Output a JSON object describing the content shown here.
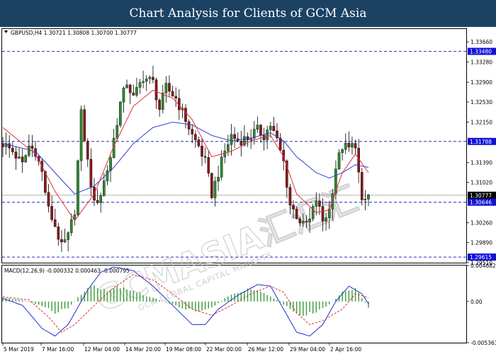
{
  "page_title": "Chart Analysis for Clients of GCM Asia",
  "watermark": {
    "main": "GCMASIA汇汇汇",
    "sub": "GCM GLOBAL CAPITAL MARKETS"
  },
  "colors": {
    "header_bg": "#1b4263",
    "bull_candle": "#2e8b2e",
    "bear_candle": "#8b1a1a",
    "ma_fast": "#e0303a",
    "ma_slow": "#2f3fd0",
    "level_line": "#2030c0",
    "label_bg": "#1010d8",
    "macd_hist": "#3a9a3a",
    "macd_signal": "#e03030",
    "macd_line": "#1f2fd0"
  },
  "chart_data": [
    {
      "type": "candlestick",
      "header": "GBPUSD,H4  1.30721 1.30808 1.30700 1.30777",
      "symbol": "GBPUSD",
      "timeframe": "H4",
      "ohlc_last": {
        "open": 1.30721,
        "high": 1.30808,
        "low": 1.307,
        "close": 1.30777
      },
      "ylim": [
        1.2951,
        1.339
      ],
      "y_ticks": [
        "1.33660",
        "1.33280",
        "1.32900",
        "1.32530",
        "1.32150",
        "1.31390",
        "1.31020",
        "1.30260",
        "1.29890",
        "1.29510"
      ],
      "x_ticks": [
        "5 Mar 2019",
        "7 Mar 16:00",
        "12 Mar 04:00",
        "14 Mar 20:00",
        "19 Mar 08:00",
        "22 Mar 00:00",
        "26 Mar 12:00",
        "29 Mar 04:00",
        "2 Apr 16:00"
      ],
      "levels": [
        {
          "value": 1.3348,
          "label": "1.33480"
        },
        {
          "value": 1.31788,
          "label": "1.31788"
        },
        {
          "value": 1.30646,
          "label": "1.30646"
        },
        {
          "value": 1.29615,
          "label": "1.29615"
        }
      ],
      "current_price": {
        "value": 1.30777,
        "label": "1.30777"
      },
      "close_path": [
        [
          0,
          1.3175
        ],
        [
          3,
          1.316
        ],
        [
          6,
          1.3135
        ],
        [
          8,
          1.317
        ],
        [
          10,
          1.316
        ],
        [
          12,
          1.312
        ],
        [
          14,
          1.305
        ],
        [
          16,
          1.302
        ],
        [
          18,
          1.298
        ],
        [
          20,
          1.3
        ],
        [
          22,
          1.305
        ],
        [
          24,
          1.323
        ],
        [
          26,
          1.314
        ],
        [
          28,
          1.306
        ],
        [
          30,
          1.308
        ],
        [
          33,
          1.315
        ],
        [
          36,
          1.325
        ],
        [
          38,
          1.329
        ],
        [
          40,
          1.326
        ],
        [
          43,
          1.33
        ],
        [
          46,
          1.329
        ],
        [
          48,
          1.324
        ],
        [
          50,
          1.328
        ],
        [
          53,
          1.326
        ],
        [
          56,
          1.322
        ],
        [
          58,
          1.319
        ],
        [
          60,
          1.317
        ],
        [
          62,
          1.314
        ],
        [
          64,
          1.308
        ],
        [
          66,
          1.312
        ],
        [
          68,
          1.316
        ],
        [
          70,
          1.319
        ],
        [
          72,
          1.318
        ],
        [
          75,
          1.3185
        ],
        [
          78,
          1.32
        ],
        [
          80,
          1.319
        ],
        [
          82,
          1.321
        ],
        [
          84,
          1.318
        ],
        [
          86,
          1.314
        ],
        [
          88,
          1.306
        ],
        [
          90,
          1.304
        ],
        [
          92,
          1.302
        ],
        [
          94,
          1.303
        ],
        [
          96,
          1.307
        ],
        [
          98,
          1.303
        ],
        [
          100,
          1.305
        ],
        [
          102,
          1.313
        ],
        [
          104,
          1.317
        ],
        [
          106,
          1.3165
        ],
        [
          108,
          1.3175
        ],
        [
          110,
          1.306
        ],
        [
          112,
          1.30777
        ]
      ],
      "ma_fast_path": [
        [
          0,
          1.3205
        ],
        [
          10,
          1.3155
        ],
        [
          16,
          1.3085
        ],
        [
          22,
          1.303
        ],
        [
          28,
          1.308
        ],
        [
          34,
          1.317
        ],
        [
          40,
          1.3245
        ],
        [
          46,
          1.3275
        ],
        [
          52,
          1.326
        ],
        [
          58,
          1.322
        ],
        [
          64,
          1.315
        ],
        [
          70,
          1.316
        ],
        [
          76,
          1.318
        ],
        [
          82,
          1.319
        ],
        [
          86,
          1.315
        ],
        [
          90,
          1.308
        ],
        [
          96,
          1.3045
        ],
        [
          100,
          1.305
        ],
        [
          104,
          1.312
        ],
        [
          108,
          1.3155
        ],
        [
          112,
          1.312
        ]
      ],
      "ma_slow_path": [
        [
          0,
          1.3175
        ],
        [
          10,
          1.316
        ],
        [
          16,
          1.312
        ],
        [
          22,
          1.308
        ],
        [
          28,
          1.3095
        ],
        [
          34,
          1.313
        ],
        [
          40,
          1.3175
        ],
        [
          46,
          1.3205
        ],
        [
          52,
          1.3215
        ],
        [
          58,
          1.321
        ],
        [
          64,
          1.319
        ],
        [
          70,
          1.318
        ],
        [
          76,
          1.3185
        ],
        [
          82,
          1.3195
        ],
        [
          86,
          1.318
        ],
        [
          90,
          1.315
        ],
        [
          96,
          1.312
        ],
        [
          100,
          1.311
        ],
        [
          104,
          1.312
        ],
        [
          108,
          1.3135
        ],
        [
          112,
          1.313
        ]
      ]
    },
    {
      "type": "macd",
      "header": "MACD(12,26,9) -0.000332 0.000463 -0.000795",
      "params": "12,26,9",
      "values": {
        "macd": -0.000332,
        "signal": 0.000463,
        "histogram": -0.000795
      },
      "ylim": [
        -0.005363,
        0.004682
      ],
      "y_ticks": [
        "0.004682",
        "0.00",
        "-0.005363"
      ],
      "hist_path": [
        [
          0,
          0.0005
        ],
        [
          6,
          0.0002
        ],
        [
          12,
          -0.0006
        ],
        [
          16,
          -0.0014
        ],
        [
          20,
          -0.0009
        ],
        [
          24,
          0.001
        ],
        [
          28,
          0.0022
        ],
        [
          32,
          0.0015
        ],
        [
          36,
          0.002
        ],
        [
          40,
          0.0014
        ],
        [
          44,
          0.0007
        ],
        [
          48,
          0.0002
        ],
        [
          52,
          -0.0004
        ],
        [
          56,
          -0.001
        ],
        [
          60,
          -0.0012
        ],
        [
          64,
          -0.0008
        ],
        [
          68,
          0.0004
        ],
        [
          72,
          0.0012
        ],
        [
          76,
          0.0016
        ],
        [
          80,
          0.001
        ],
        [
          84,
          0.0002
        ],
        [
          88,
          -0.001
        ],
        [
          92,
          -0.0018
        ],
        [
          96,
          -0.0014
        ],
        [
          100,
          -0.0004
        ],
        [
          104,
          0.0012
        ],
        [
          108,
          0.0018
        ],
        [
          112,
          -0.0008
        ]
      ],
      "signal_path": [
        [
          0,
          0.0006
        ],
        [
          8,
          0.0002
        ],
        [
          14,
          -0.002
        ],
        [
          18,
          -0.004
        ],
        [
          22,
          -0.003
        ],
        [
          28,
          -0.0005
        ],
        [
          34,
          0.0018
        ],
        [
          40,
          0.0035
        ],
        [
          46,
          0.0028
        ],
        [
          52,
          0.001
        ],
        [
          58,
          -0.001
        ],
        [
          64,
          -0.0018
        ],
        [
          70,
          -0.0005
        ],
        [
          76,
          0.001
        ],
        [
          82,
          0.002
        ],
        [
          86,
          0.0012
        ],
        [
          90,
          -0.0015
        ],
        [
          94,
          -0.003
        ],
        [
          98,
          -0.0025
        ],
        [
          104,
          -0.001
        ],
        [
          108,
          0.001
        ],
        [
          112,
          0.0005
        ]
      ],
      "macd_path": [
        [
          0,
          0.0004
        ],
        [
          6,
          -0.0005
        ],
        [
          12,
          -0.0035
        ],
        [
          16,
          -0.0045
        ],
        [
          20,
          -0.003
        ],
        [
          26,
          0.0015
        ],
        [
          30,
          0.0038
        ],
        [
          34,
          0.0045
        ],
        [
          40,
          0.004
        ],
        [
          46,
          0.002
        ],
        [
          52,
          -0.0005
        ],
        [
          58,
          -0.003
        ],
        [
          62,
          -0.003
        ],
        [
          66,
          -0.001
        ],
        [
          72,
          0.0008
        ],
        [
          78,
          0.0022
        ],
        [
          82,
          0.002
        ],
        [
          86,
          -0.001
        ],
        [
          90,
          -0.004
        ],
        [
          94,
          -0.0045
        ],
        [
          98,
          -0.003
        ],
        [
          102,
          0.0
        ],
        [
          106,
          0.002
        ],
        [
          110,
          0.001
        ],
        [
          112,
          -0.0003
        ]
      ]
    }
  ]
}
